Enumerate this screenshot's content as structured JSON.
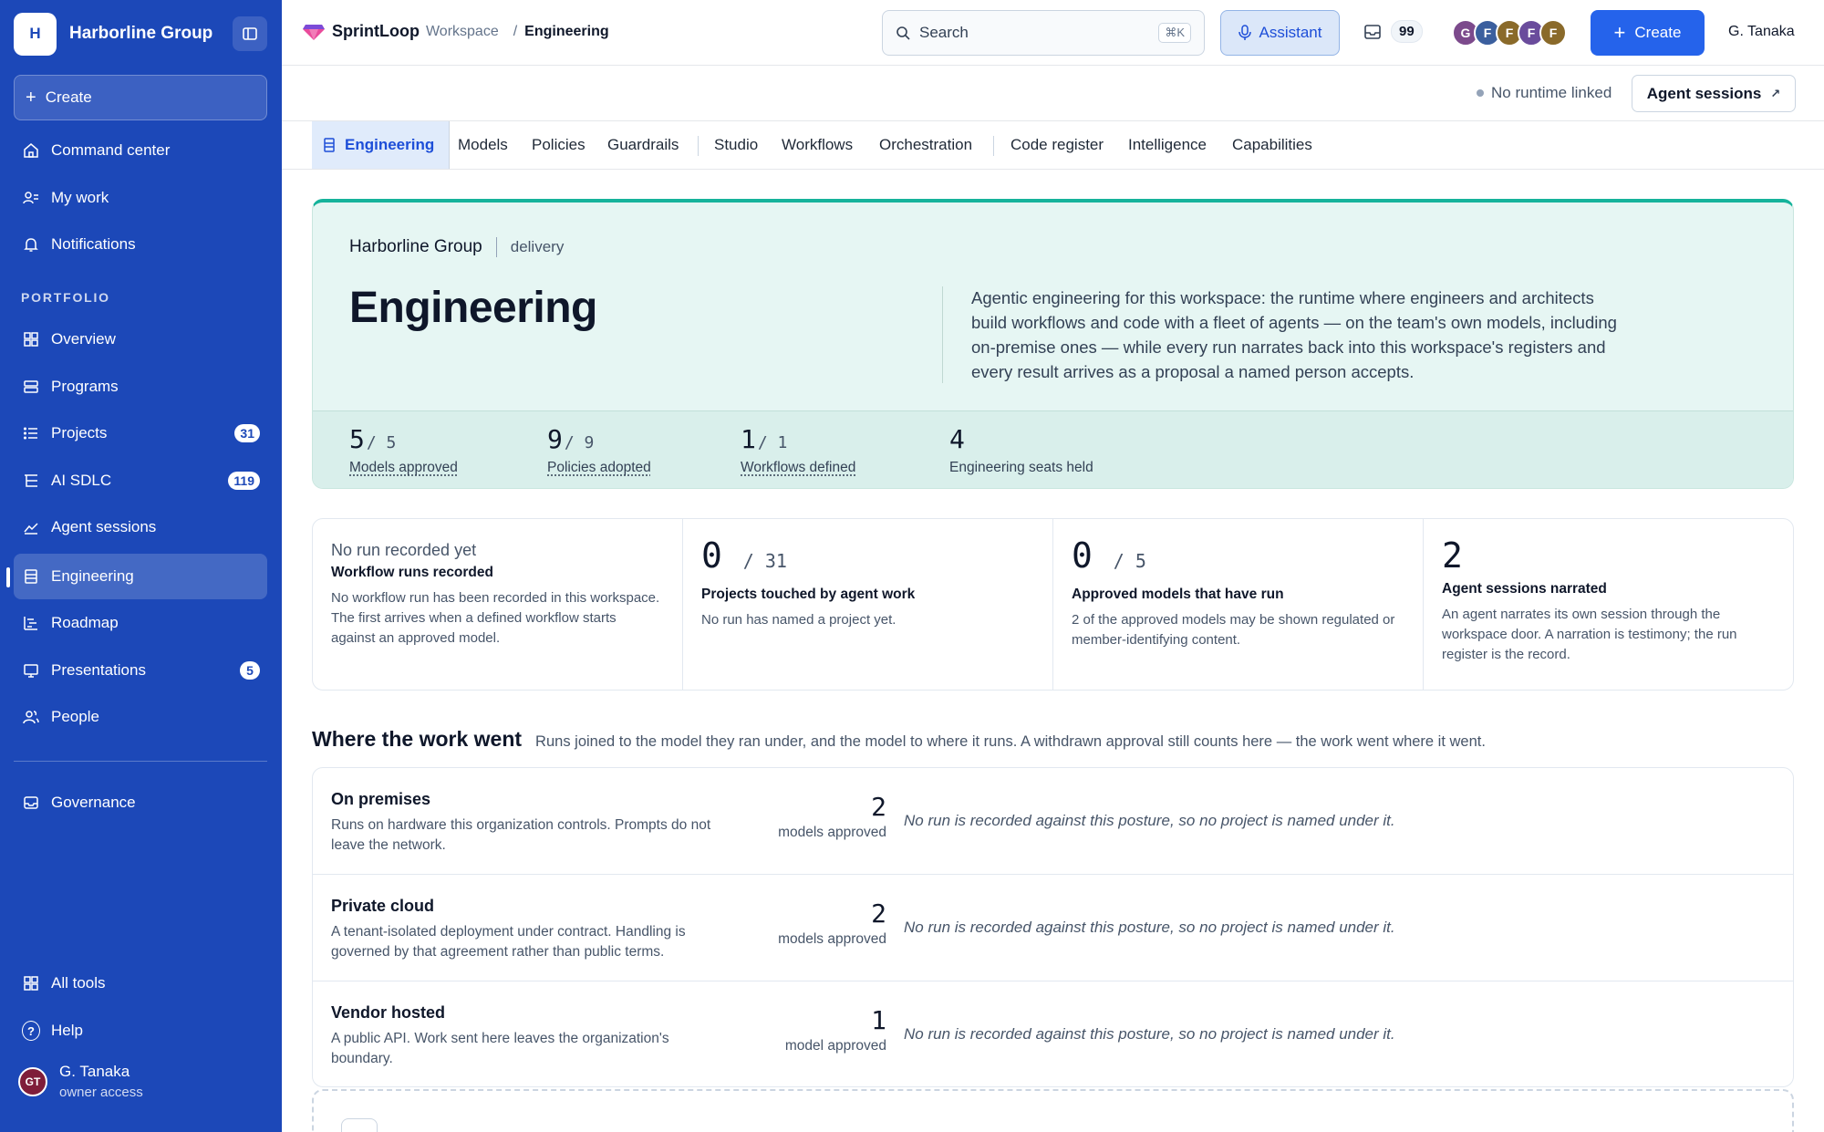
{
  "sidebar": {
    "org_initial": "H",
    "org_name": "Harborline Group",
    "create_label": "Create",
    "top_items": [
      {
        "label": "Command center",
        "icon": "home-icon"
      },
      {
        "label": "My work",
        "icon": "user-list-icon"
      },
      {
        "label": "Notifications",
        "icon": "bell-icon"
      }
    ],
    "section_label": "PORTFOLIO",
    "portfolio_items": [
      {
        "label": "Overview",
        "icon": "grid-icon"
      },
      {
        "label": "Programs",
        "icon": "layers-icon"
      },
      {
        "label": "Projects",
        "icon": "list-icon",
        "badge": "31"
      },
      {
        "label": "AI SDLC",
        "icon": "tree-icon",
        "badge": "119"
      },
      {
        "label": "Agent sessions",
        "icon": "chart-icon"
      },
      {
        "label": "Engineering",
        "icon": "panel-icon",
        "active": true
      },
      {
        "label": "Roadmap",
        "icon": "roadmap-icon"
      },
      {
        "label": "Presentations",
        "icon": "monitor-icon",
        "badge": "5"
      },
      {
        "label": "People",
        "icon": "people-icon"
      }
    ],
    "governance_label": "Governance",
    "all_tools_label": "All tools",
    "help_label": "Help",
    "user": {
      "initials": "GT",
      "name": "G. Tanaka",
      "role": "owner access"
    }
  },
  "topbar": {
    "brand": "SprintLoop",
    "workspace": "Workspace",
    "breadcrumb_sep": "/",
    "breadcrumb_current": "Engineering",
    "search_placeholder": "Search",
    "search_shortcut": "⌘K",
    "assistant_label": "Assistant",
    "inbox_count": "99",
    "avatars": [
      {
        "initial": "G",
        "color": "#7c4a8c"
      },
      {
        "initial": "F",
        "color": "#3b5f9e"
      },
      {
        "initial": "F",
        "color": "#8a6a2a"
      },
      {
        "initial": "F",
        "color": "#6a4c9c"
      },
      {
        "initial": "F",
        "color": "#8a6a2a"
      }
    ],
    "create_label": "Create",
    "user_name": "G. Tanaka"
  },
  "subbar": {
    "runtime_status": "No runtime linked",
    "agent_sessions_label": "Agent sessions"
  },
  "tabs": {
    "active": "Engineering",
    "group1": [
      "Models",
      "Policies",
      "Guardrails"
    ],
    "group2": [
      "Studio",
      "Workflows",
      "Orchestration"
    ],
    "group3": [
      "Code register",
      "Intelligence",
      "Capabilities"
    ]
  },
  "hero": {
    "org": "Harborline Group",
    "unit": "delivery",
    "title": "Engineering",
    "description": "Agentic engineering for this workspace: the runtime where engineers and architects build workflows and code with a fleet of agents — on the team's own models, including on-premise ones — while every run narrates back into this workspace's registers and every result arrives as a proposal a named person accepts.",
    "stats": [
      {
        "value": "5",
        "total": "/ 5",
        "label": "Models approved"
      },
      {
        "value": "9",
        "total": "/ 9",
        "label": "Policies adopted"
      },
      {
        "value": "1",
        "total": "/ 1",
        "label": "Workflows defined"
      },
      {
        "value": "4",
        "total": "",
        "label": "Engineering seats held"
      }
    ]
  },
  "cards": [
    {
      "headline": "No run recorded yet",
      "title": "Workflow runs recorded",
      "text": "No workflow run has been recorded in this workspace. The first arrives when a defined workflow starts against an approved model."
    },
    {
      "value": "0",
      "total": "/ 31",
      "title": "Projects touched by agent work",
      "text": "No run has named a project yet."
    },
    {
      "value": "0",
      "total": "/ 5",
      "title": "Approved models that have run",
      "text": "2 of the approved models may be shown regulated or member-identifying content."
    },
    {
      "value": "2",
      "total": "",
      "title": "Agent sessions narrated",
      "text": "An agent narrates its own session through the workspace door. A narration is testimony; the run register is the record."
    }
  ],
  "where": {
    "title": "Where the work went",
    "note": "Runs joined to the model they ran under, and the model to where it runs. A withdrawn approval still counts here — the work went where it went.",
    "postures": [
      {
        "name": "On premises",
        "desc": "Runs on hardware this organization controls. Prompts do not leave the network.",
        "count": "2",
        "unit": "models approved",
        "note": "No run is recorded against this posture, so no project is named under it."
      },
      {
        "name": "Private cloud",
        "desc": "A tenant-isolated deployment under contract. Handling is governed by that agreement rather than public terms.",
        "count": "2",
        "unit": "models approved",
        "note": "No run is recorded against this posture, so no project is named under it."
      },
      {
        "name": "Vendor hosted",
        "desc": "A public API. Work sent here leaves the organization's boundary.",
        "count": "1",
        "unit": "model approved",
        "note": "No run is recorded against this posture, so no project is named under it."
      }
    ]
  },
  "colors": {
    "sidebar_bg": "#1c48b8",
    "primary": "#2563eb",
    "hero_bg": "#e6f6f3",
    "hero_accent": "#16b39b"
  }
}
